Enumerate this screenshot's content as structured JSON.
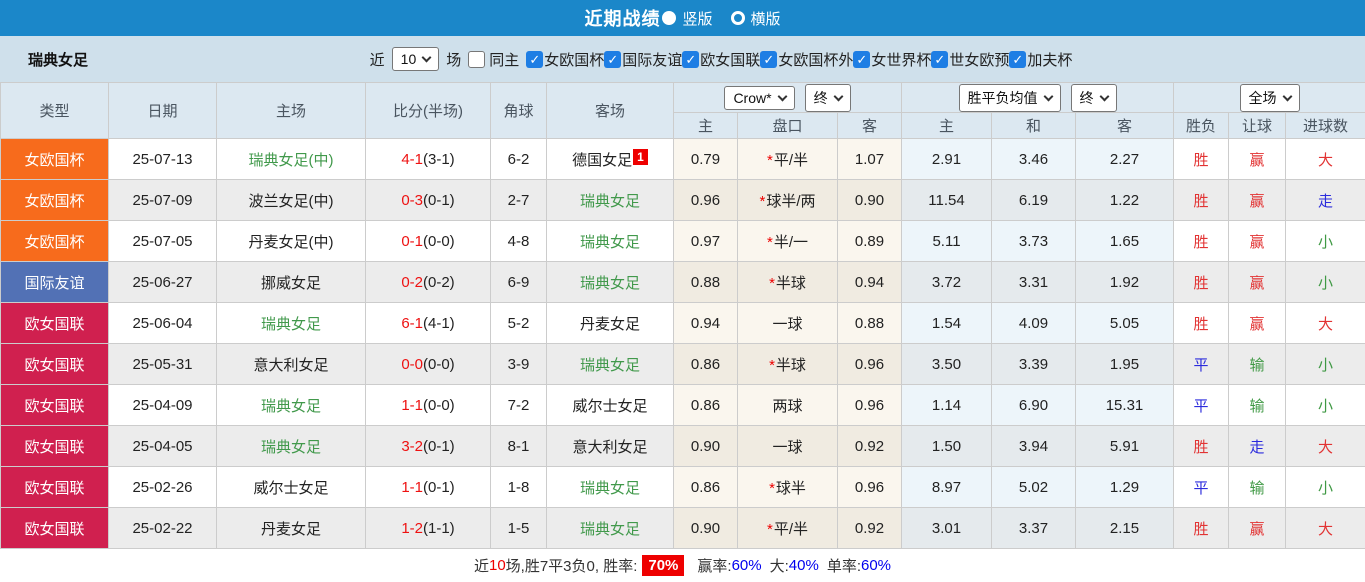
{
  "colors": {
    "topbar_bg": "#1b87c9",
    "filterbar_bg": "#cfe0eb",
    "header_bg": "#dce8f1",
    "header_text": "#4a5560",
    "type_orange": "#f76b1c",
    "type_blue": "#5271b5",
    "type_crimson": "#d0204f",
    "team_green": "#41994b",
    "score_red": "#ee1111",
    "result_red": "#e23333",
    "result_blue": "#2b2bdd",
    "result_green": "#3f9944",
    "checkbox_blue": "#1e7ee4",
    "odds_bg": "#faf6ee",
    "odds_bg_alt": "#f0ebe1",
    "avg_bg": "#edf5fa",
    "avg_bg_alt": "#e5eaed",
    "row_alt": "#ececec",
    "border": "#cccccc",
    "footer_blue": "#0000ee",
    "badge_red": "#ee0000"
  },
  "topbar": {
    "title": "近期战绩",
    "radio_vertical": "竖版",
    "radio_horizontal": "横版"
  },
  "filterbar": {
    "team": "瑞典女足",
    "near_label": "近",
    "count_value": "10",
    "games_label": "场",
    "same_home_label": "同主",
    "competitions": [
      "女欧国杯",
      "国际友谊",
      "欧女国联",
      "女欧国杯外",
      "女世界杯",
      "世女欧预",
      "加夫杯"
    ]
  },
  "table": {
    "headers": {
      "main": [
        "类型",
        "日期",
        "主场",
        "比分(半场)",
        "角球",
        "客场"
      ],
      "sub": [
        "主",
        "盘口",
        "客",
        "主",
        "和",
        "客",
        "胜负",
        "让球",
        "进球数"
      ]
    },
    "dropdowns": {
      "odds_company": "Crow*",
      "odds_time": "终",
      "avg_label": "胜平负均值",
      "avg_time": "终",
      "scope": "全场"
    },
    "rows": [
      {
        "type": "女欧国杯",
        "type_color": "orange",
        "date": "25-07-13",
        "home": "瑞典女足(中)",
        "home_is_target": true,
        "score_ft": "4-1",
        "score_ht": "(3-1)",
        "corners": "6-2",
        "away": "德国女足",
        "away_is_target": false,
        "away_badge": "1",
        "odds_home": "0.79",
        "handicap_star": true,
        "handicap": "平/半",
        "odds_away": "1.07",
        "avg_home": "2.91",
        "avg_draw": "3.46",
        "avg_away": "2.27",
        "result": "胜",
        "result_color": "red",
        "let_result": "赢",
        "let_color": "red",
        "goals": "大",
        "goals_color": "red"
      },
      {
        "type": "女欧国杯",
        "type_color": "orange",
        "date": "25-07-09",
        "home": "波兰女足(中)",
        "home_is_target": false,
        "score_ft": "0-3",
        "score_ht": "(0-1)",
        "corners": "2-7",
        "away": "瑞典女足",
        "away_is_target": true,
        "away_badge": "",
        "odds_home": "0.96",
        "handicap_star": true,
        "handicap": "球半/两",
        "odds_away": "0.90",
        "avg_home": "11.54",
        "avg_draw": "6.19",
        "avg_away": "1.22",
        "result": "胜",
        "result_color": "red",
        "let_result": "赢",
        "let_color": "red",
        "goals": "走",
        "goals_color": "blue"
      },
      {
        "type": "女欧国杯",
        "type_color": "orange",
        "date": "25-07-05",
        "home": "丹麦女足(中)",
        "home_is_target": false,
        "score_ft": "0-1",
        "score_ht": "(0-0)",
        "corners": "4-8",
        "away": "瑞典女足",
        "away_is_target": true,
        "away_badge": "",
        "odds_home": "0.97",
        "handicap_star": true,
        "handicap": "半/一",
        "odds_away": "0.89",
        "avg_home": "5.11",
        "avg_draw": "3.73",
        "avg_away": "1.65",
        "result": "胜",
        "result_color": "red",
        "let_result": "赢",
        "let_color": "red",
        "goals": "小",
        "goals_color": "green"
      },
      {
        "type": "国际友谊",
        "type_color": "blue",
        "date": "25-06-27",
        "home": "挪威女足",
        "home_is_target": false,
        "score_ft": "0-2",
        "score_ht": "(0-2)",
        "corners": "6-9",
        "away": "瑞典女足",
        "away_is_target": true,
        "away_badge": "",
        "odds_home": "0.88",
        "handicap_star": true,
        "handicap": "半球",
        "odds_away": "0.94",
        "avg_home": "3.72",
        "avg_draw": "3.31",
        "avg_away": "1.92",
        "result": "胜",
        "result_color": "red",
        "let_result": "赢",
        "let_color": "red",
        "goals": "小",
        "goals_color": "green"
      },
      {
        "type": "欧女国联",
        "type_color": "crimson",
        "date": "25-06-04",
        "home": "瑞典女足",
        "home_is_target": true,
        "score_ft": "6-1",
        "score_ht": "(4-1)",
        "corners": "5-2",
        "away": "丹麦女足",
        "away_is_target": false,
        "away_badge": "",
        "odds_home": "0.94",
        "handicap_star": false,
        "handicap": "一球",
        "odds_away": "0.88",
        "avg_home": "1.54",
        "avg_draw": "4.09",
        "avg_away": "5.05",
        "result": "胜",
        "result_color": "red",
        "let_result": "赢",
        "let_color": "red",
        "goals": "大",
        "goals_color": "red"
      },
      {
        "type": "欧女国联",
        "type_color": "crimson",
        "date": "25-05-31",
        "home": "意大利女足",
        "home_is_target": false,
        "score_ft": "0-0",
        "score_ht": "(0-0)",
        "corners": "3-9",
        "away": "瑞典女足",
        "away_is_target": true,
        "away_badge": "",
        "odds_home": "0.86",
        "handicap_star": true,
        "handicap": "半球",
        "odds_away": "0.96",
        "avg_home": "3.50",
        "avg_draw": "3.39",
        "avg_away": "1.95",
        "result": "平",
        "result_color": "blue",
        "let_result": "输",
        "let_color": "green",
        "goals": "小",
        "goals_color": "green"
      },
      {
        "type": "欧女国联",
        "type_color": "crimson",
        "date": "25-04-09",
        "home": "瑞典女足",
        "home_is_target": true,
        "score_ft": "1-1",
        "score_ht": "(0-0)",
        "corners": "7-2",
        "away": "威尔士女足",
        "away_is_target": false,
        "away_badge": "",
        "odds_home": "0.86",
        "handicap_star": false,
        "handicap": "两球",
        "odds_away": "0.96",
        "avg_home": "1.14",
        "avg_draw": "6.90",
        "avg_away": "15.31",
        "result": "平",
        "result_color": "blue",
        "let_result": "输",
        "let_color": "green",
        "goals": "小",
        "goals_color": "green"
      },
      {
        "type": "欧女国联",
        "type_color": "crimson",
        "date": "25-04-05",
        "home": "瑞典女足",
        "home_is_target": true,
        "score_ft": "3-2",
        "score_ht": "(0-1)",
        "corners": "8-1",
        "away": "意大利女足",
        "away_is_target": false,
        "away_badge": "",
        "odds_home": "0.90",
        "handicap_star": false,
        "handicap": "一球",
        "odds_away": "0.92",
        "avg_home": "1.50",
        "avg_draw": "3.94",
        "avg_away": "5.91",
        "result": "胜",
        "result_color": "red",
        "let_result": "走",
        "let_color": "blue",
        "goals": "大",
        "goals_color": "red"
      },
      {
        "type": "欧女国联",
        "type_color": "crimson",
        "date": "25-02-26",
        "home": "威尔士女足",
        "home_is_target": false,
        "score_ft": "1-1",
        "score_ht": "(0-1)",
        "corners": "1-8",
        "away": "瑞典女足",
        "away_is_target": true,
        "away_badge": "",
        "odds_home": "0.86",
        "handicap_star": true,
        "handicap": "球半",
        "odds_away": "0.96",
        "avg_home": "8.97",
        "avg_draw": "5.02",
        "avg_away": "1.29",
        "result": "平",
        "result_color": "blue",
        "let_result": "输",
        "let_color": "green",
        "goals": "小",
        "goals_color": "green"
      },
      {
        "type": "欧女国联",
        "type_color": "crimson",
        "date": "25-02-22",
        "home": "丹麦女足",
        "home_is_target": false,
        "score_ft": "1-2",
        "score_ht": "(1-1)",
        "corners": "1-5",
        "away": "瑞典女足",
        "away_is_target": true,
        "away_badge": "",
        "odds_home": "0.90",
        "handicap_star": true,
        "handicap": "平/半",
        "odds_away": "0.92",
        "avg_home": "3.01",
        "avg_draw": "3.37",
        "avg_away": "2.15",
        "result": "胜",
        "result_color": "red",
        "let_result": "赢",
        "let_color": "red",
        "goals": "大",
        "goals_color": "red"
      }
    ]
  },
  "footer": {
    "prefix": "近",
    "count": "10",
    "summary": "场,胜7平3负0, 胜率:",
    "win_rate": "70%",
    "handicap_label": "赢率:",
    "handicap_rate": "60%",
    "big_label": "大:",
    "big_rate": "40%",
    "single_label": "单率:",
    "single_rate": "60%"
  }
}
